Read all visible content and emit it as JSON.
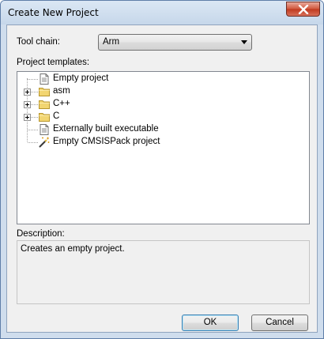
{
  "window": {
    "title": "Create New Project"
  },
  "toolchain": {
    "label": "Tool chain:",
    "selected": "Arm"
  },
  "templates": {
    "label": "Project templates:",
    "items": [
      {
        "label": "Empty project",
        "icon": "document-icon",
        "expandable": false
      },
      {
        "label": "asm",
        "icon": "folder-icon",
        "expandable": true
      },
      {
        "label": "C++",
        "icon": "folder-icon",
        "expandable": true
      },
      {
        "label": "C",
        "icon": "folder-icon",
        "expandable": true
      },
      {
        "label": "Externally built executable",
        "icon": "document-icon",
        "expandable": false
      },
      {
        "label": "Empty CMSISPack project",
        "icon": "magic-wand-icon",
        "expandable": false
      }
    ]
  },
  "description": {
    "label": "Description:",
    "text": "Creates an empty project."
  },
  "buttons": {
    "ok": "OK",
    "cancel": "Cancel"
  },
  "colors": {
    "folder": "#f2d571",
    "close_button": "#c9412a"
  }
}
